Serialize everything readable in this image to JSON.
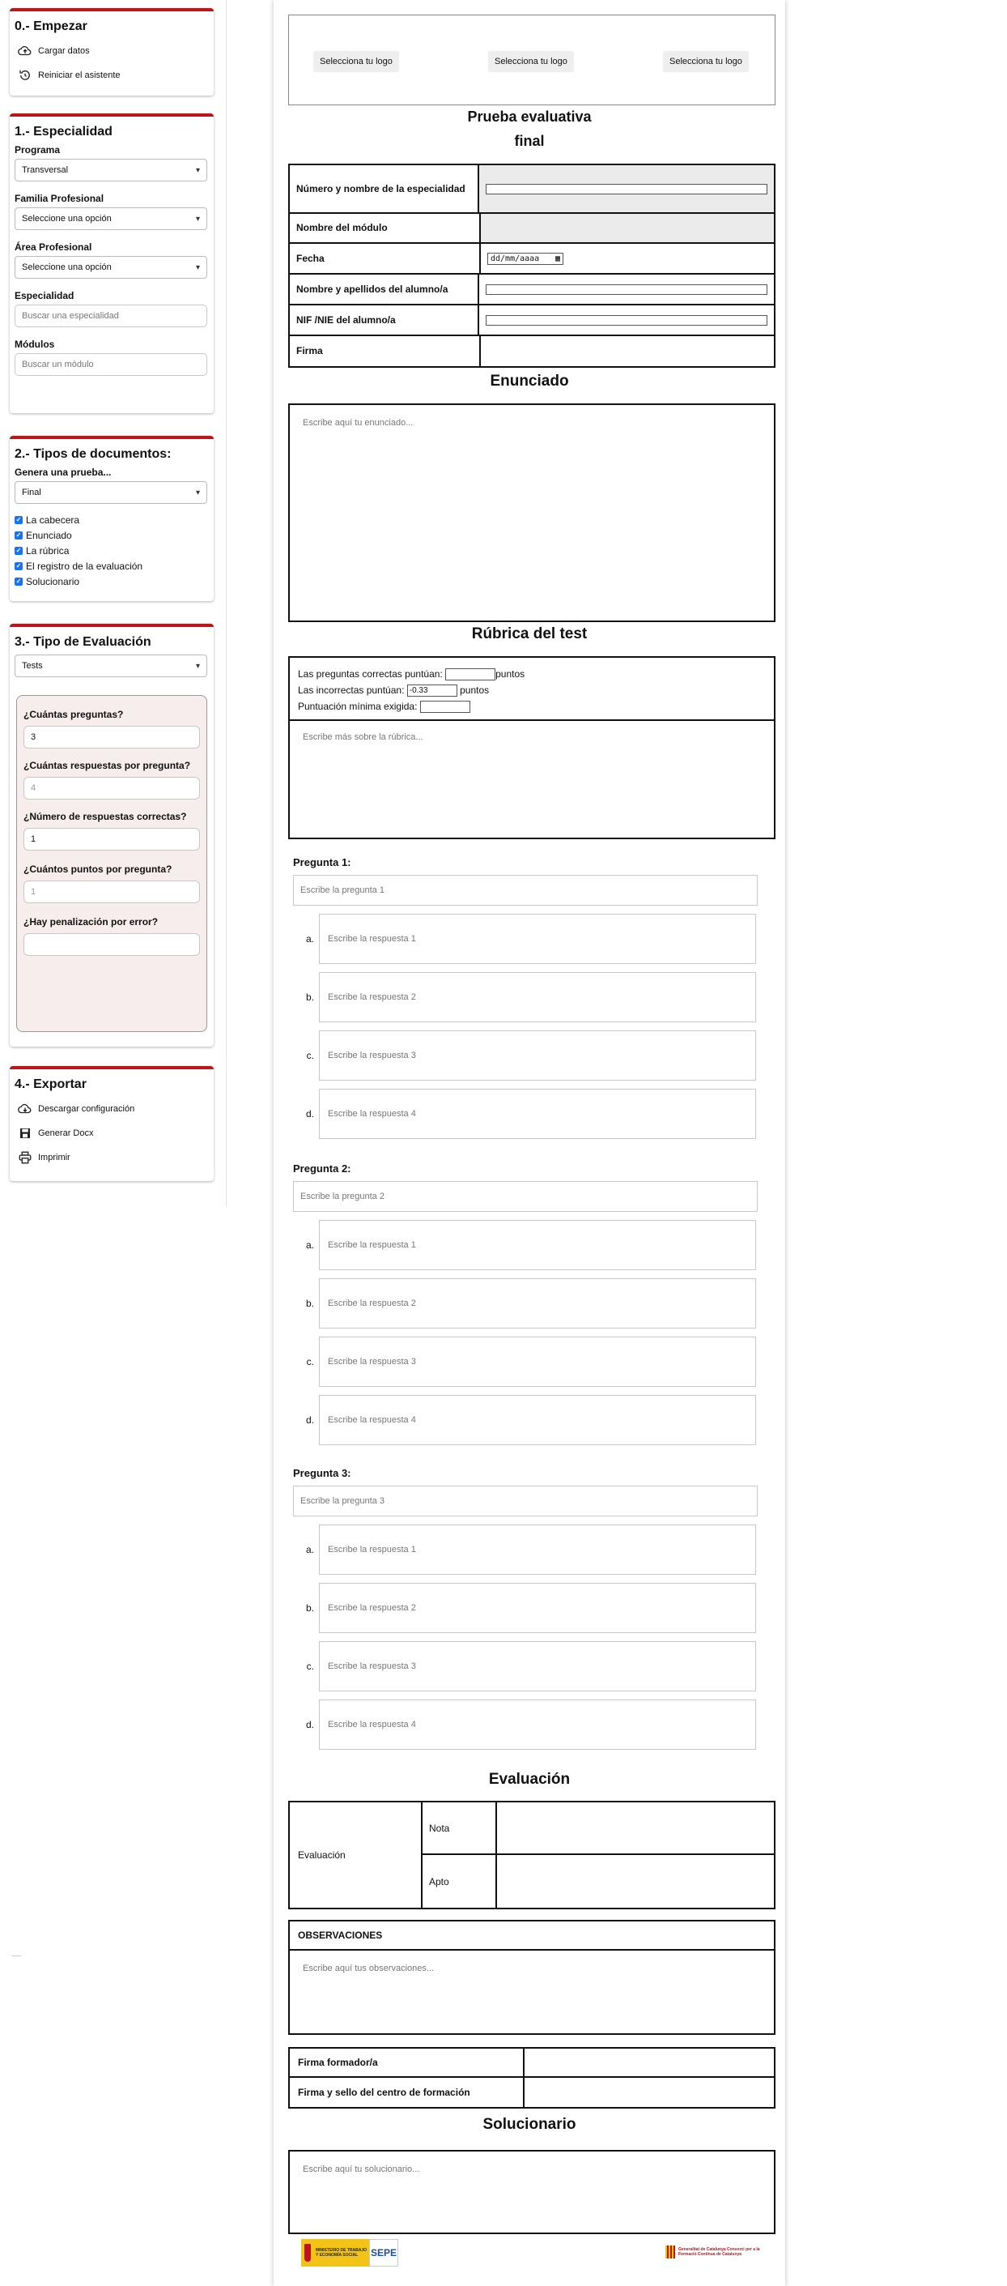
{
  "sidebar": {
    "start": {
      "title": "0.- Empezar",
      "load_label": "Cargar datos",
      "reset_label": "Reiniciar el asistente"
    },
    "specialty": {
      "title": "1.- Especialidad",
      "programa_label": "Programa",
      "programa_value": "Transversal",
      "familia_label": "Familia Profesional",
      "familia_value": "Seleccione una opción",
      "area_label": "Área Profesional",
      "area_value": "Seleccione una opción",
      "especialidad_label": "Especialidad",
      "especialidad_placeholder": "Buscar una especialidad",
      "modulos_label": "Módulos",
      "modulos_placeholder": "Buscar un módulo"
    },
    "doc_types": {
      "title": "2.- Tipos de documentos:",
      "genera_label": "Genera una prueba...",
      "genera_value": "Final",
      "checks": [
        "La cabecera",
        "Enunciado",
        "La rúbrica",
        "El registro de la evaluación",
        "Solucionario"
      ]
    },
    "eval_type": {
      "title": "3.- Tipo de Evaluación",
      "type_value": "Tests",
      "q_count_label": "¿Cuántas preguntas?",
      "q_count_value": "3",
      "answers_label": "¿Cuántas respuestas por pregunta?",
      "answers_placeholder": "4",
      "correct_label": "¿Número de respuestas correctas?",
      "correct_value": "1",
      "points_label": "¿Cuántos puntos por pregunta?",
      "points_placeholder": "1",
      "penalty_label": "¿Hay penalización por error?",
      "penalty_value": ""
    },
    "export": {
      "title": "4.- Exportar",
      "download_label": "Descargar configuración",
      "docx_label": "Generar Docx",
      "print_label": "Imprimir"
    }
  },
  "doc": {
    "logo_button": "Selecciona tu logo",
    "title_line1": "Prueba evaluativa",
    "title_line2": "final",
    "header_rows": {
      "especialidad": "Número y nombre de la especialidad",
      "modulo": "Nombre del módulo",
      "fecha": "Fecha",
      "fecha_placeholder": "dd/mm/aaaa",
      "alumno": "Nombre y apellidos del alumno/a",
      "nif": "NIF /NIE del alumno/a",
      "firma": "Firma"
    },
    "enunciado_title": "Enunciado",
    "enunciado_placeholder": "Escribe aquí tu enunciado...",
    "rubric_title": "Rúbrica del test",
    "rubric_correct_pre": "Las preguntas correctas puntúan:",
    "rubric_correct_post": "puntos",
    "rubric_incorrect_pre": "Las incorrectas puntúan:",
    "rubric_incorrect_value": "-0.33",
    "rubric_incorrect_post": "puntos",
    "rubric_min": "Puntuación mínima exigida:",
    "rubric_placeholder": "Escribe más sobre la rúbrica...",
    "questions": [
      {
        "label": "Pregunta 1:",
        "placeholder": "Escribe la pregunta 1"
      },
      {
        "label": "Pregunta 2:",
        "placeholder": "Escribe la pregunta 2"
      },
      {
        "label": "Pregunta 3:",
        "placeholder": "Escribe la pregunta 3"
      }
    ],
    "answer_letters": [
      "a.",
      "b.",
      "c.",
      "d."
    ],
    "answer_placeholders": [
      "Escribe la respuesta 1",
      "Escribe la respuesta 2",
      "Escribe la respuesta 3",
      "Escribe la respuesta 4"
    ],
    "evaluacion_title": "Evaluación",
    "evaluacion_label": "Evaluación",
    "nota_label": "Nota",
    "apto_label": "Apto",
    "observaciones_title": "OBSERVACIONES",
    "observaciones_placeholder": "Escribe aquí tus observaciones...",
    "firma_formador": "Firma formador/a",
    "firma_sello": "Firma y sello del centro de formación",
    "solucionario_title": "Solucionario",
    "solucionario_placeholder": "Escribe aquí tu solucionario..."
  },
  "footer": {
    "ministry_text": "MINISTERIO DE TRABAJO Y ECONOMÍA SOCIAL",
    "sepe_text": "SEPE",
    "gencat_text": "Generalitat de Catalunya Consorci per a la Formació Contínua de Catalunya"
  },
  "colors": {
    "accent_red": "#c0141b",
    "checkbox_blue": "#1a73e8",
    "eval_panel_bg": "#f7eded"
  }
}
